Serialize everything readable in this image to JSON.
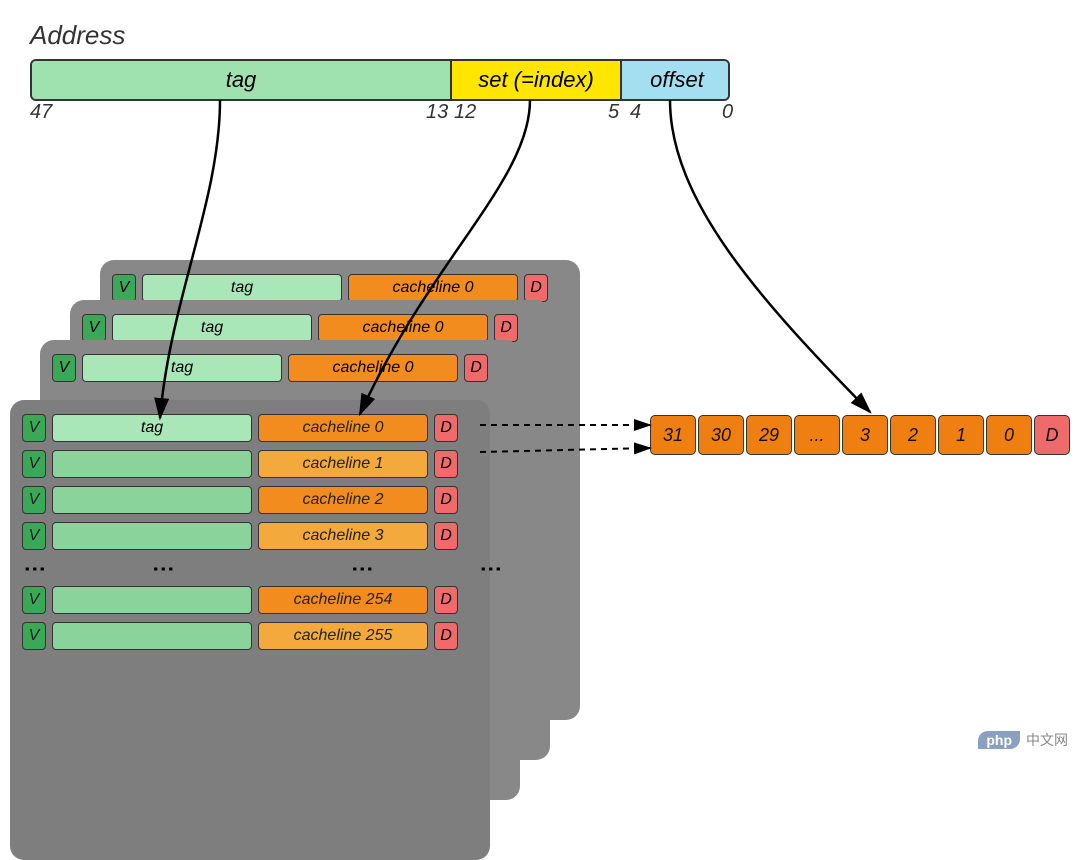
{
  "title": "Address",
  "address_bar": {
    "tag_label": "tag",
    "set_label": "set (=index)",
    "offset_label": "offset",
    "bit_47": "47",
    "bit_13": "13",
    "bit_12": "12",
    "bit_5": "5",
    "bit_4": "4",
    "bit_0": "0"
  },
  "row_labels": {
    "v": "V",
    "d": "D",
    "tag": "tag"
  },
  "cachelines": {
    "l0": "cacheline 0",
    "l1": "cacheline 1",
    "l2": "cacheline 2",
    "l3": "cacheline 3",
    "l254": "cacheline 254",
    "l255": "cacheline 255"
  },
  "bytes": {
    "b31": "31",
    "b30": "30",
    "b29": "29",
    "dots": "...",
    "b3": "3",
    "b2": "2",
    "b1": "1",
    "b0": "0",
    "d": "D"
  },
  "watermark": {
    "pill": "php",
    "text": "中文网"
  },
  "chart_data": {
    "type": "diagram",
    "concept": "Set-associative CPU cache address decomposition",
    "address_bits": 48,
    "fields": [
      {
        "name": "tag",
        "hi_bit": 47,
        "lo_bit": 13,
        "width_bits": 35,
        "color": "#9fe2b0"
      },
      {
        "name": "set",
        "hi_bit": 12,
        "lo_bit": 5,
        "width_bits": 8,
        "label": "set (=index)",
        "color": "#ffe600"
      },
      {
        "name": "offset",
        "hi_bit": 4,
        "lo_bit": 0,
        "width_bits": 5,
        "color": "#a3dff0"
      }
    ],
    "num_sets": 256,
    "num_ways_shown": 4,
    "cacheline_bytes": 32,
    "cache_entry_columns": [
      "V",
      "tag",
      "cacheline",
      "D"
    ],
    "cacheline_rows_shown": [
      0,
      1,
      2,
      3,
      "...",
      254,
      255
    ],
    "byte_cells_shown": [
      "31",
      "30",
      "29",
      "...",
      "3",
      "2",
      "1",
      "0",
      "D"
    ],
    "arrows": [
      {
        "from": "address.tag",
        "to": "cache_entry.tag"
      },
      {
        "from": "address.set",
        "to": "cache_entry.cacheline_index"
      },
      {
        "from": "address.offset",
        "to": "cacheline.byte"
      },
      {
        "from": "cache_entry.cacheline",
        "to": "byte_row",
        "style": "dashed"
      }
    ]
  }
}
